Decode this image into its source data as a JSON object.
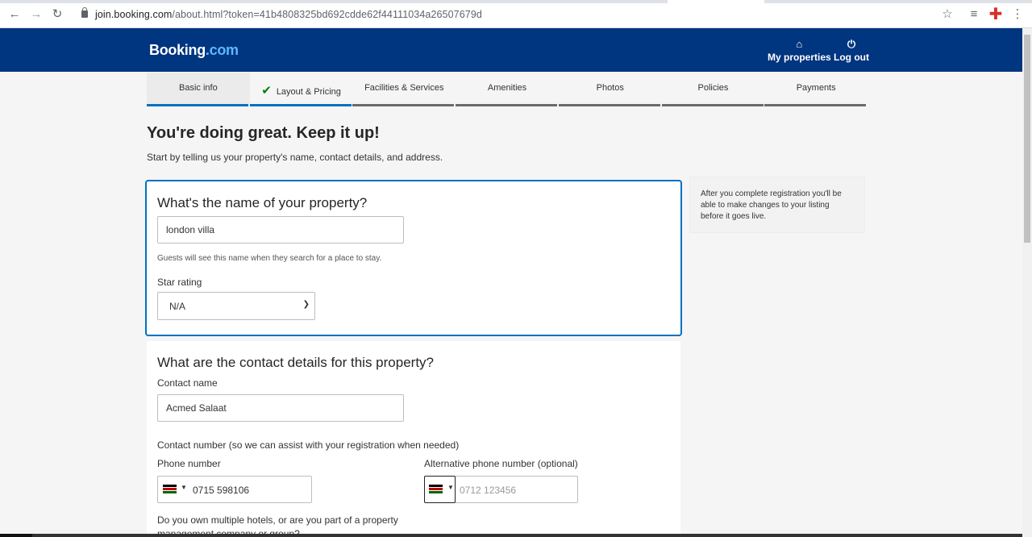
{
  "browser": {
    "url_host": "join.booking.com",
    "url_path": "/about.html?token=41b4808325bd692cdde62f44111034a26507679d",
    "back_icon": "arrow-left-icon",
    "forward_icon": "arrow-right-icon",
    "reload_icon": "reload-icon"
  },
  "header": {
    "logo_main": "Booking",
    "logo_dot": ".com",
    "my_properties": "My properties",
    "log_out": "Log out"
  },
  "steps": [
    {
      "label": "Basic info",
      "state": "active"
    },
    {
      "label": "Layout & Pricing",
      "state": "done"
    },
    {
      "label": "Facilities & Services",
      "state": "todo"
    },
    {
      "label": "Amenities",
      "state": "todo"
    },
    {
      "label": "Photos",
      "state": "todo"
    },
    {
      "label": "Policies",
      "state": "todo"
    },
    {
      "label": "Payments",
      "state": "todo"
    }
  ],
  "page": {
    "title": "You're doing great. Keep it up!",
    "subtitle": "Start by telling us your property's name, contact details, and address."
  },
  "property_card": {
    "title": "What's the name of your property?",
    "name_value": "london villa",
    "name_hint": "Guests will see this name when they search for a place to stay.",
    "star_label": "Star rating",
    "star_value": "N/A"
  },
  "side_note": {
    "text": "After you complete registration you'll be able to make changes to your listing before it goes live."
  },
  "contact_card": {
    "title": "What are the contact details for this property?",
    "contact_name_label": "Contact name",
    "contact_name_value": "Acmed Salaat",
    "contact_number_label": "Contact number (so we can assist with your registration when needed)",
    "phone_label": "Phone number",
    "phone_value": "0715 598106",
    "alt_phone_label": "Alternative phone number (optional)",
    "alt_phone_placeholder": "0712 123456",
    "multiple_hotels_line1": "Do you own multiple hotels, or are you part of a property",
    "multiple_hotels_line2": "management company or group?"
  },
  "colors": {
    "brand": "#003580",
    "accent": "#0071c2",
    "success": "#008009"
  }
}
